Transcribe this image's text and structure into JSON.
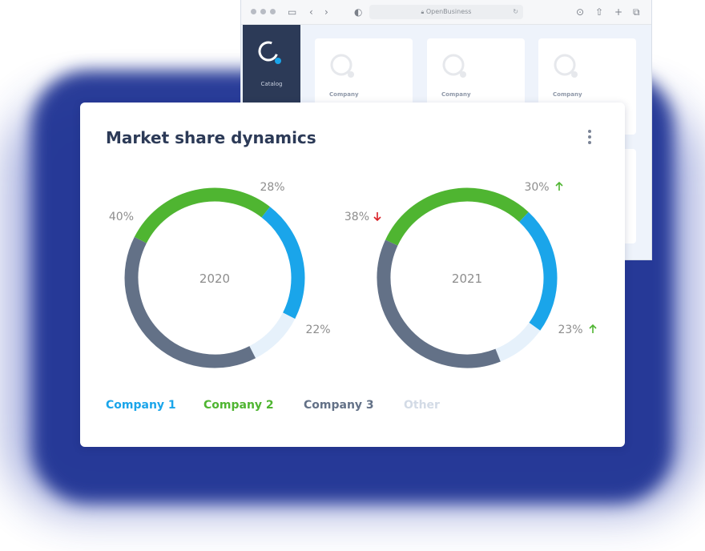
{
  "browser": {
    "url": "OpenBusiness",
    "sidebar_label": "Catalog",
    "cards": [
      "Company",
      "Company",
      "Company"
    ]
  },
  "card": {
    "title": "Market share dynamics"
  },
  "colors": {
    "company1": "#1aa5ea",
    "company2": "#4fb531",
    "company3": "#637187",
    "other": "#e6f1fb",
    "up": "#4fb531",
    "down": "#d91f26",
    "label": "#8d8d8d"
  },
  "chart_data": [
    {
      "type": "pie",
      "title": "2020",
      "series": [
        {
          "name": "Company 1",
          "value": 22
        },
        {
          "name": "Company 2",
          "value": 28
        },
        {
          "name": "Company 3",
          "value": 40
        },
        {
          "name": "Other",
          "value": 10
        }
      ],
      "labels": {
        "Company 1": "22%",
        "Company 2": "28%",
        "Company 3": "40%"
      }
    },
    {
      "type": "pie",
      "title": "2021",
      "series": [
        {
          "name": "Company 1",
          "value": 23,
          "trend": "up"
        },
        {
          "name": "Company 2",
          "value": 30,
          "trend": "up"
        },
        {
          "name": "Company 3",
          "value": 38,
          "trend": "down"
        },
        {
          "name": "Other",
          "value": 9
        }
      ],
      "labels": {
        "Company 1": "23%",
        "Company 2": "30%",
        "Company 3": "38%"
      }
    }
  ],
  "legend": [
    "Company 1",
    "Company 2",
    "Company 3",
    "Other"
  ]
}
